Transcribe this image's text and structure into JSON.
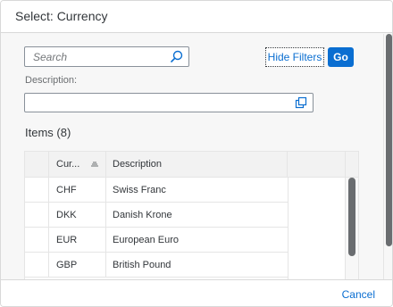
{
  "dialog": {
    "title": "Select: Currency"
  },
  "filters": {
    "search_placeholder": "Search",
    "hide_filters_label": "Hide Filters",
    "go_label": "Go",
    "description_label": "Description:",
    "description_value": ""
  },
  "table": {
    "title": "Items (8)",
    "columns": [
      "Cur...",
      "Description"
    ],
    "rows": [
      {
        "code": "CHF",
        "description": "Swiss Franc"
      },
      {
        "code": "DKK",
        "description": "Danish Krone"
      },
      {
        "code": "EUR",
        "description": "European Euro"
      },
      {
        "code": "GBP",
        "description": "British Pound"
      }
    ]
  },
  "footer": {
    "cancel_label": "Cancel"
  },
  "colors": {
    "accent": "#0a6ed1",
    "text": "#32363a",
    "background": "#f7f7f7"
  }
}
